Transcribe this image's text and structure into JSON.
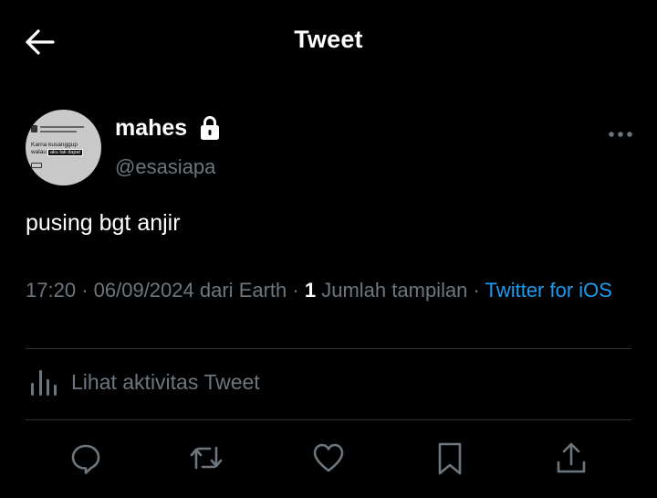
{
  "header": {
    "title": "Tweet",
    "back_icon": "arrow-left-icon"
  },
  "author": {
    "display_name": "mahes",
    "handle": "@esasiapa",
    "protected_icon": "lock-icon",
    "avatar_text_line1": "Karna kusanggup",
    "avatar_text_line2": "walau",
    "avatar_text_boxed": "aku tak dapat",
    "more_icon": "more-dots-icon"
  },
  "tweet": {
    "text": "pusing bgt anjir"
  },
  "meta": {
    "time": "17:20",
    "date": "06/09/2024",
    "location_prefix": "dari",
    "location": "Earth",
    "views_count": "1",
    "views_label": "Jumlah tampilan",
    "separator": "·",
    "source": "Twitter for iOS"
  },
  "activity": {
    "label": "Lihat aktivitas Tweet",
    "icon": "bar-chart-icon"
  },
  "actions": [
    {
      "name": "reply",
      "icon": "reply-icon"
    },
    {
      "name": "retweet",
      "icon": "retweet-icon"
    },
    {
      "name": "like",
      "icon": "heart-icon"
    },
    {
      "name": "bookmark",
      "icon": "bookmark-icon"
    },
    {
      "name": "share",
      "icon": "share-icon"
    }
  ],
  "colors": {
    "background": "#000000",
    "text": "#ffffff",
    "secondary": "#6e767d",
    "link": "#1d9bf0",
    "divider": "#2f3336"
  }
}
